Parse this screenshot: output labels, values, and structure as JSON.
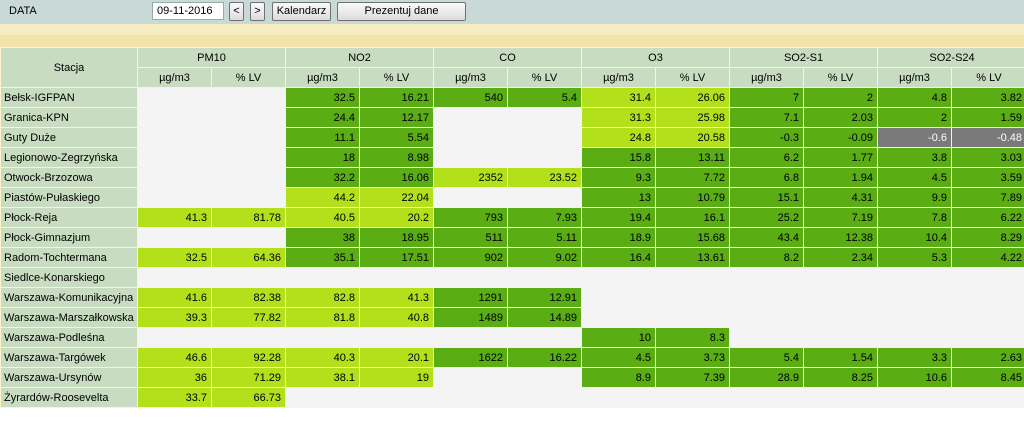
{
  "toolbar": {
    "label": "DATA",
    "date": "09-11-2016",
    "prev": "<",
    "next": ">",
    "calendar": "Kalendarz",
    "present": "Prezentuj dane"
  },
  "table": {
    "station_header": "Stacja",
    "groups": [
      "PM10",
      "NO2",
      "CO",
      "O3",
      "SO2-S1",
      "SO2-S24"
    ],
    "unit_abs": "µg/m3",
    "unit_lv": "% LV",
    "colors": {
      "green": "#5aad12",
      "light_green": "#b2e11c",
      "empty": "#f4f4f4",
      "gray": "#7a7a7a"
    },
    "rows": [
      {
        "station": "Bełsk-IGFPAN",
        "cells": [
          [
            "",
            "e"
          ],
          [
            "",
            "e"
          ],
          [
            "32.5",
            "g"
          ],
          [
            "16.21",
            "g"
          ],
          [
            "540",
            "g"
          ],
          [
            "5.4",
            "g"
          ],
          [
            "31.4",
            "lg"
          ],
          [
            "26.06",
            "lg"
          ],
          [
            "7",
            "g"
          ],
          [
            "2",
            "g"
          ],
          [
            "4.8",
            "g"
          ],
          [
            "3.82",
            "g"
          ]
        ]
      },
      {
        "station": "Granica-KPN",
        "cells": [
          [
            "",
            "e"
          ],
          [
            "",
            "e"
          ],
          [
            "24.4",
            "g"
          ],
          [
            "12.17",
            "g"
          ],
          [
            "",
            "e"
          ],
          [
            "",
            "e"
          ],
          [
            "31.3",
            "lg"
          ],
          [
            "25.98",
            "lg"
          ],
          [
            "7.1",
            "g"
          ],
          [
            "2.03",
            "g"
          ],
          [
            "2",
            "g"
          ],
          [
            "1.59",
            "g"
          ]
        ]
      },
      {
        "station": "Guty Duże",
        "cells": [
          [
            "",
            "e"
          ],
          [
            "",
            "e"
          ],
          [
            "11.1",
            "g"
          ],
          [
            "5.54",
            "g"
          ],
          [
            "",
            "e"
          ],
          [
            "",
            "e"
          ],
          [
            "24.8",
            "lg"
          ],
          [
            "20.58",
            "lg"
          ],
          [
            "-0.3",
            "g"
          ],
          [
            "-0.09",
            "g"
          ],
          [
            "-0.6",
            "gr"
          ],
          [
            "-0.48",
            "gr"
          ]
        ]
      },
      {
        "station": "Legionowo-Zegrzyńska",
        "cells": [
          [
            "",
            "e"
          ],
          [
            "",
            "e"
          ],
          [
            "18",
            "g"
          ],
          [
            "8.98",
            "g"
          ],
          [
            "",
            "e"
          ],
          [
            "",
            "e"
          ],
          [
            "15.8",
            "g"
          ],
          [
            "13.11",
            "g"
          ],
          [
            "6.2",
            "g"
          ],
          [
            "1.77",
            "g"
          ],
          [
            "3.8",
            "g"
          ],
          [
            "3.03",
            "g"
          ]
        ]
      },
      {
        "station": "Otwock-Brzozowa",
        "cells": [
          [
            "",
            "e"
          ],
          [
            "",
            "e"
          ],
          [
            "32.2",
            "g"
          ],
          [
            "16.06",
            "g"
          ],
          [
            "2352",
            "lg"
          ],
          [
            "23.52",
            "lg"
          ],
          [
            "9.3",
            "g"
          ],
          [
            "7.72",
            "g"
          ],
          [
            "6.8",
            "g"
          ],
          [
            "1.94",
            "g"
          ],
          [
            "4.5",
            "g"
          ],
          [
            "3.59",
            "g"
          ]
        ]
      },
      {
        "station": "Piastów-Pułaskiego",
        "cells": [
          [
            "",
            "e"
          ],
          [
            "",
            "e"
          ],
          [
            "44.2",
            "lg"
          ],
          [
            "22.04",
            "lg"
          ],
          [
            "",
            "e"
          ],
          [
            "",
            "e"
          ],
          [
            "13",
            "g"
          ],
          [
            "10.79",
            "g"
          ],
          [
            "15.1",
            "g"
          ],
          [
            "4.31",
            "g"
          ],
          [
            "9.9",
            "g"
          ],
          [
            "7.89",
            "g"
          ]
        ]
      },
      {
        "station": "Płock-Reja",
        "cells": [
          [
            "41.3",
            "lg"
          ],
          [
            "81.78",
            "lg"
          ],
          [
            "40.5",
            "lg"
          ],
          [
            "20.2",
            "lg"
          ],
          [
            "793",
            "g"
          ],
          [
            "7.93",
            "g"
          ],
          [
            "19.4",
            "g"
          ],
          [
            "16.1",
            "g"
          ],
          [
            "25.2",
            "g"
          ],
          [
            "7.19",
            "g"
          ],
          [
            "7.8",
            "g"
          ],
          [
            "6.22",
            "g"
          ]
        ]
      },
      {
        "station": "Płock-Gimnazjum",
        "cells": [
          [
            "",
            "e"
          ],
          [
            "",
            "e"
          ],
          [
            "38",
            "g"
          ],
          [
            "18.95",
            "g"
          ],
          [
            "511",
            "g"
          ],
          [
            "5.11",
            "g"
          ],
          [
            "18.9",
            "g"
          ],
          [
            "15.68",
            "g"
          ],
          [
            "43.4",
            "g"
          ],
          [
            "12.38",
            "g"
          ],
          [
            "10.4",
            "g"
          ],
          [
            "8.29",
            "g"
          ]
        ]
      },
      {
        "station": "Radom-Tochtermana",
        "cells": [
          [
            "32.5",
            "lg"
          ],
          [
            "64.36",
            "lg"
          ],
          [
            "35.1",
            "g"
          ],
          [
            "17.51",
            "g"
          ],
          [
            "902",
            "g"
          ],
          [
            "9.02",
            "g"
          ],
          [
            "16.4",
            "g"
          ],
          [
            "13.61",
            "g"
          ],
          [
            "8.2",
            "g"
          ],
          [
            "2.34",
            "g"
          ],
          [
            "5.3",
            "g"
          ],
          [
            "4.22",
            "g"
          ]
        ]
      },
      {
        "station": "Siedlce-Konarskiego",
        "cells": [
          [
            "",
            "e"
          ],
          [
            "",
            "e"
          ],
          [
            "",
            "e"
          ],
          [
            "",
            "e"
          ],
          [
            "",
            "e"
          ],
          [
            "",
            "e"
          ],
          [
            "",
            "e"
          ],
          [
            "",
            "e"
          ],
          [
            "",
            "e"
          ],
          [
            "",
            "e"
          ],
          [
            "",
            "e"
          ],
          [
            "",
            "e"
          ]
        ]
      },
      {
        "station": "Warszawa-Komunikacyjna",
        "cells": [
          [
            "41.6",
            "lg"
          ],
          [
            "82.38",
            "lg"
          ],
          [
            "82.8",
            "lg"
          ],
          [
            "41.3",
            "lg"
          ],
          [
            "1291",
            "g"
          ],
          [
            "12.91",
            "g"
          ],
          [
            "",
            "e"
          ],
          [
            "",
            "e"
          ],
          [
            "",
            "e"
          ],
          [
            "",
            "e"
          ],
          [
            "",
            "e"
          ],
          [
            "",
            "e"
          ]
        ]
      },
      {
        "station": "Warszawa-Marszałkowska",
        "cells": [
          [
            "39.3",
            "lg"
          ],
          [
            "77.82",
            "lg"
          ],
          [
            "81.8",
            "lg"
          ],
          [
            "40.8",
            "lg"
          ],
          [
            "1489",
            "g"
          ],
          [
            "14.89",
            "g"
          ],
          [
            "",
            "e"
          ],
          [
            "",
            "e"
          ],
          [
            "",
            "e"
          ],
          [
            "",
            "e"
          ],
          [
            "",
            "e"
          ],
          [
            "",
            "e"
          ]
        ]
      },
      {
        "station": "Warszawa-Podleśna",
        "cells": [
          [
            "",
            "e"
          ],
          [
            "",
            "e"
          ],
          [
            "",
            "e"
          ],
          [
            "",
            "e"
          ],
          [
            "",
            "e"
          ],
          [
            "",
            "e"
          ],
          [
            "10",
            "g"
          ],
          [
            "8.3",
            "g"
          ],
          [
            "",
            "e"
          ],
          [
            "",
            "e"
          ],
          [
            "",
            "e"
          ],
          [
            "",
            "e"
          ]
        ]
      },
      {
        "station": "Warszawa-Targówek",
        "cells": [
          [
            "46.6",
            "lg"
          ],
          [
            "92.28",
            "lg"
          ],
          [
            "40.3",
            "lg"
          ],
          [
            "20.1",
            "lg"
          ],
          [
            "1622",
            "g"
          ],
          [
            "16.22",
            "g"
          ],
          [
            "4.5",
            "g"
          ],
          [
            "3.73",
            "g"
          ],
          [
            "5.4",
            "g"
          ],
          [
            "1.54",
            "g"
          ],
          [
            "3.3",
            "g"
          ],
          [
            "2.63",
            "g"
          ]
        ]
      },
      {
        "station": "Warszawa-Ursynów",
        "cells": [
          [
            "36",
            "lg"
          ],
          [
            "71.29",
            "lg"
          ],
          [
            "38.1",
            "lg"
          ],
          [
            "19",
            "lg"
          ],
          [
            "",
            "e"
          ],
          [
            "",
            "e"
          ],
          [
            "8.9",
            "g"
          ],
          [
            "7.39",
            "g"
          ],
          [
            "28.9",
            "g"
          ],
          [
            "8.25",
            "g"
          ],
          [
            "10.6",
            "g"
          ],
          [
            "8.45",
            "g"
          ]
        ]
      },
      {
        "station": "Żyrardów-Roosevelta",
        "cells": [
          [
            "33.7",
            "lg"
          ],
          [
            "66.73",
            "lg"
          ],
          [
            "",
            "e"
          ],
          [
            "",
            "e"
          ],
          [
            "",
            "e"
          ],
          [
            "",
            "e"
          ],
          [
            "",
            "e"
          ],
          [
            "",
            "e"
          ],
          [
            "",
            "e"
          ],
          [
            "",
            "e"
          ],
          [
            "",
            "e"
          ],
          [
            "",
            "e"
          ]
        ]
      }
    ]
  }
}
